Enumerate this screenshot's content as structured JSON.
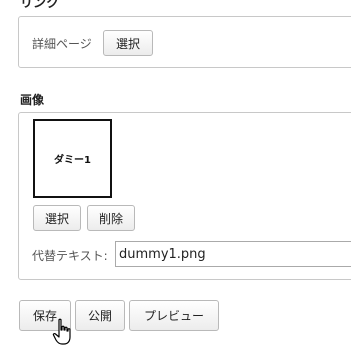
{
  "link_section": {
    "heading": "リンク",
    "detail_label": "詳細ページ",
    "select_button": "選択"
  },
  "image_section": {
    "heading": "画像",
    "thumbnail_text": "ダミー1",
    "select_button": "選択",
    "delete_button": "削除",
    "alt_label": "代替テキスト:",
    "alt_value": "dummy1.png"
  },
  "actions": {
    "save_button": "保存",
    "publish_button": "公開",
    "preview_button": "プレビュー"
  },
  "icons": {
    "cursor": "hand-pointer-icon"
  }
}
